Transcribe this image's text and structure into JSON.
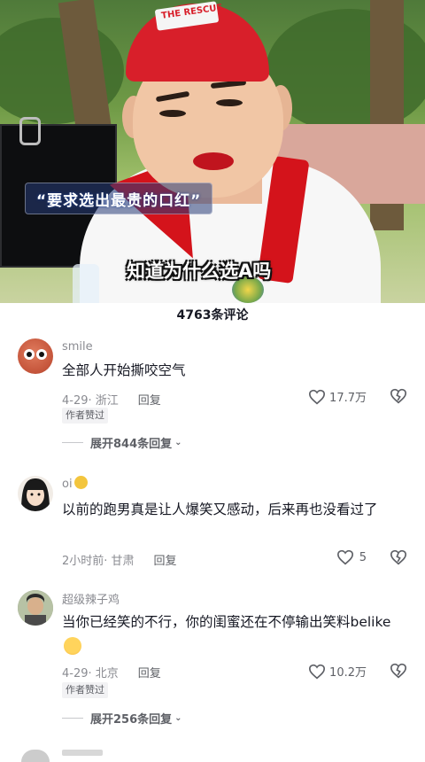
{
  "video": {
    "cap_text": "THE RESCUE",
    "caption": "“要求选出最贵的口红”",
    "subtitle": "知道为什么选A吗"
  },
  "comments_header": {
    "count_label": "4763条评论"
  },
  "comments": [
    {
      "username": "smile",
      "text": "全部人开始撕咬空气",
      "date": "4-29",
      "location": "· 浙江",
      "reply_label": "回复",
      "author_liked": "作者赞过",
      "likes": "17.7万",
      "expand_label": "展开844条回复"
    },
    {
      "username": "oi",
      "text": "以前的跑男真是让人爆笑又感动，后来再也没看过了",
      "date": "2小时前",
      "location": "· 甘肃",
      "reply_label": "回复",
      "likes": "5"
    },
    {
      "username": "超级辣子鸡",
      "text": "当你已经笑的不行，你的闺蜜还在不停输出笑料belike",
      "date": "4-29",
      "location": "· 北京",
      "reply_label": "回复",
      "author_liked": "作者赞过",
      "likes": "10.2万",
      "expand_label": "展开256条回复"
    }
  ],
  "icons": {
    "heart": "heart-outline-icon",
    "dislike": "broken-heart-icon",
    "chevron": "chevron-down-icon"
  },
  "colors": {
    "text_primary": "#161823",
    "text_secondary": "#8a8b91",
    "cap_red": "#d81f2a"
  }
}
